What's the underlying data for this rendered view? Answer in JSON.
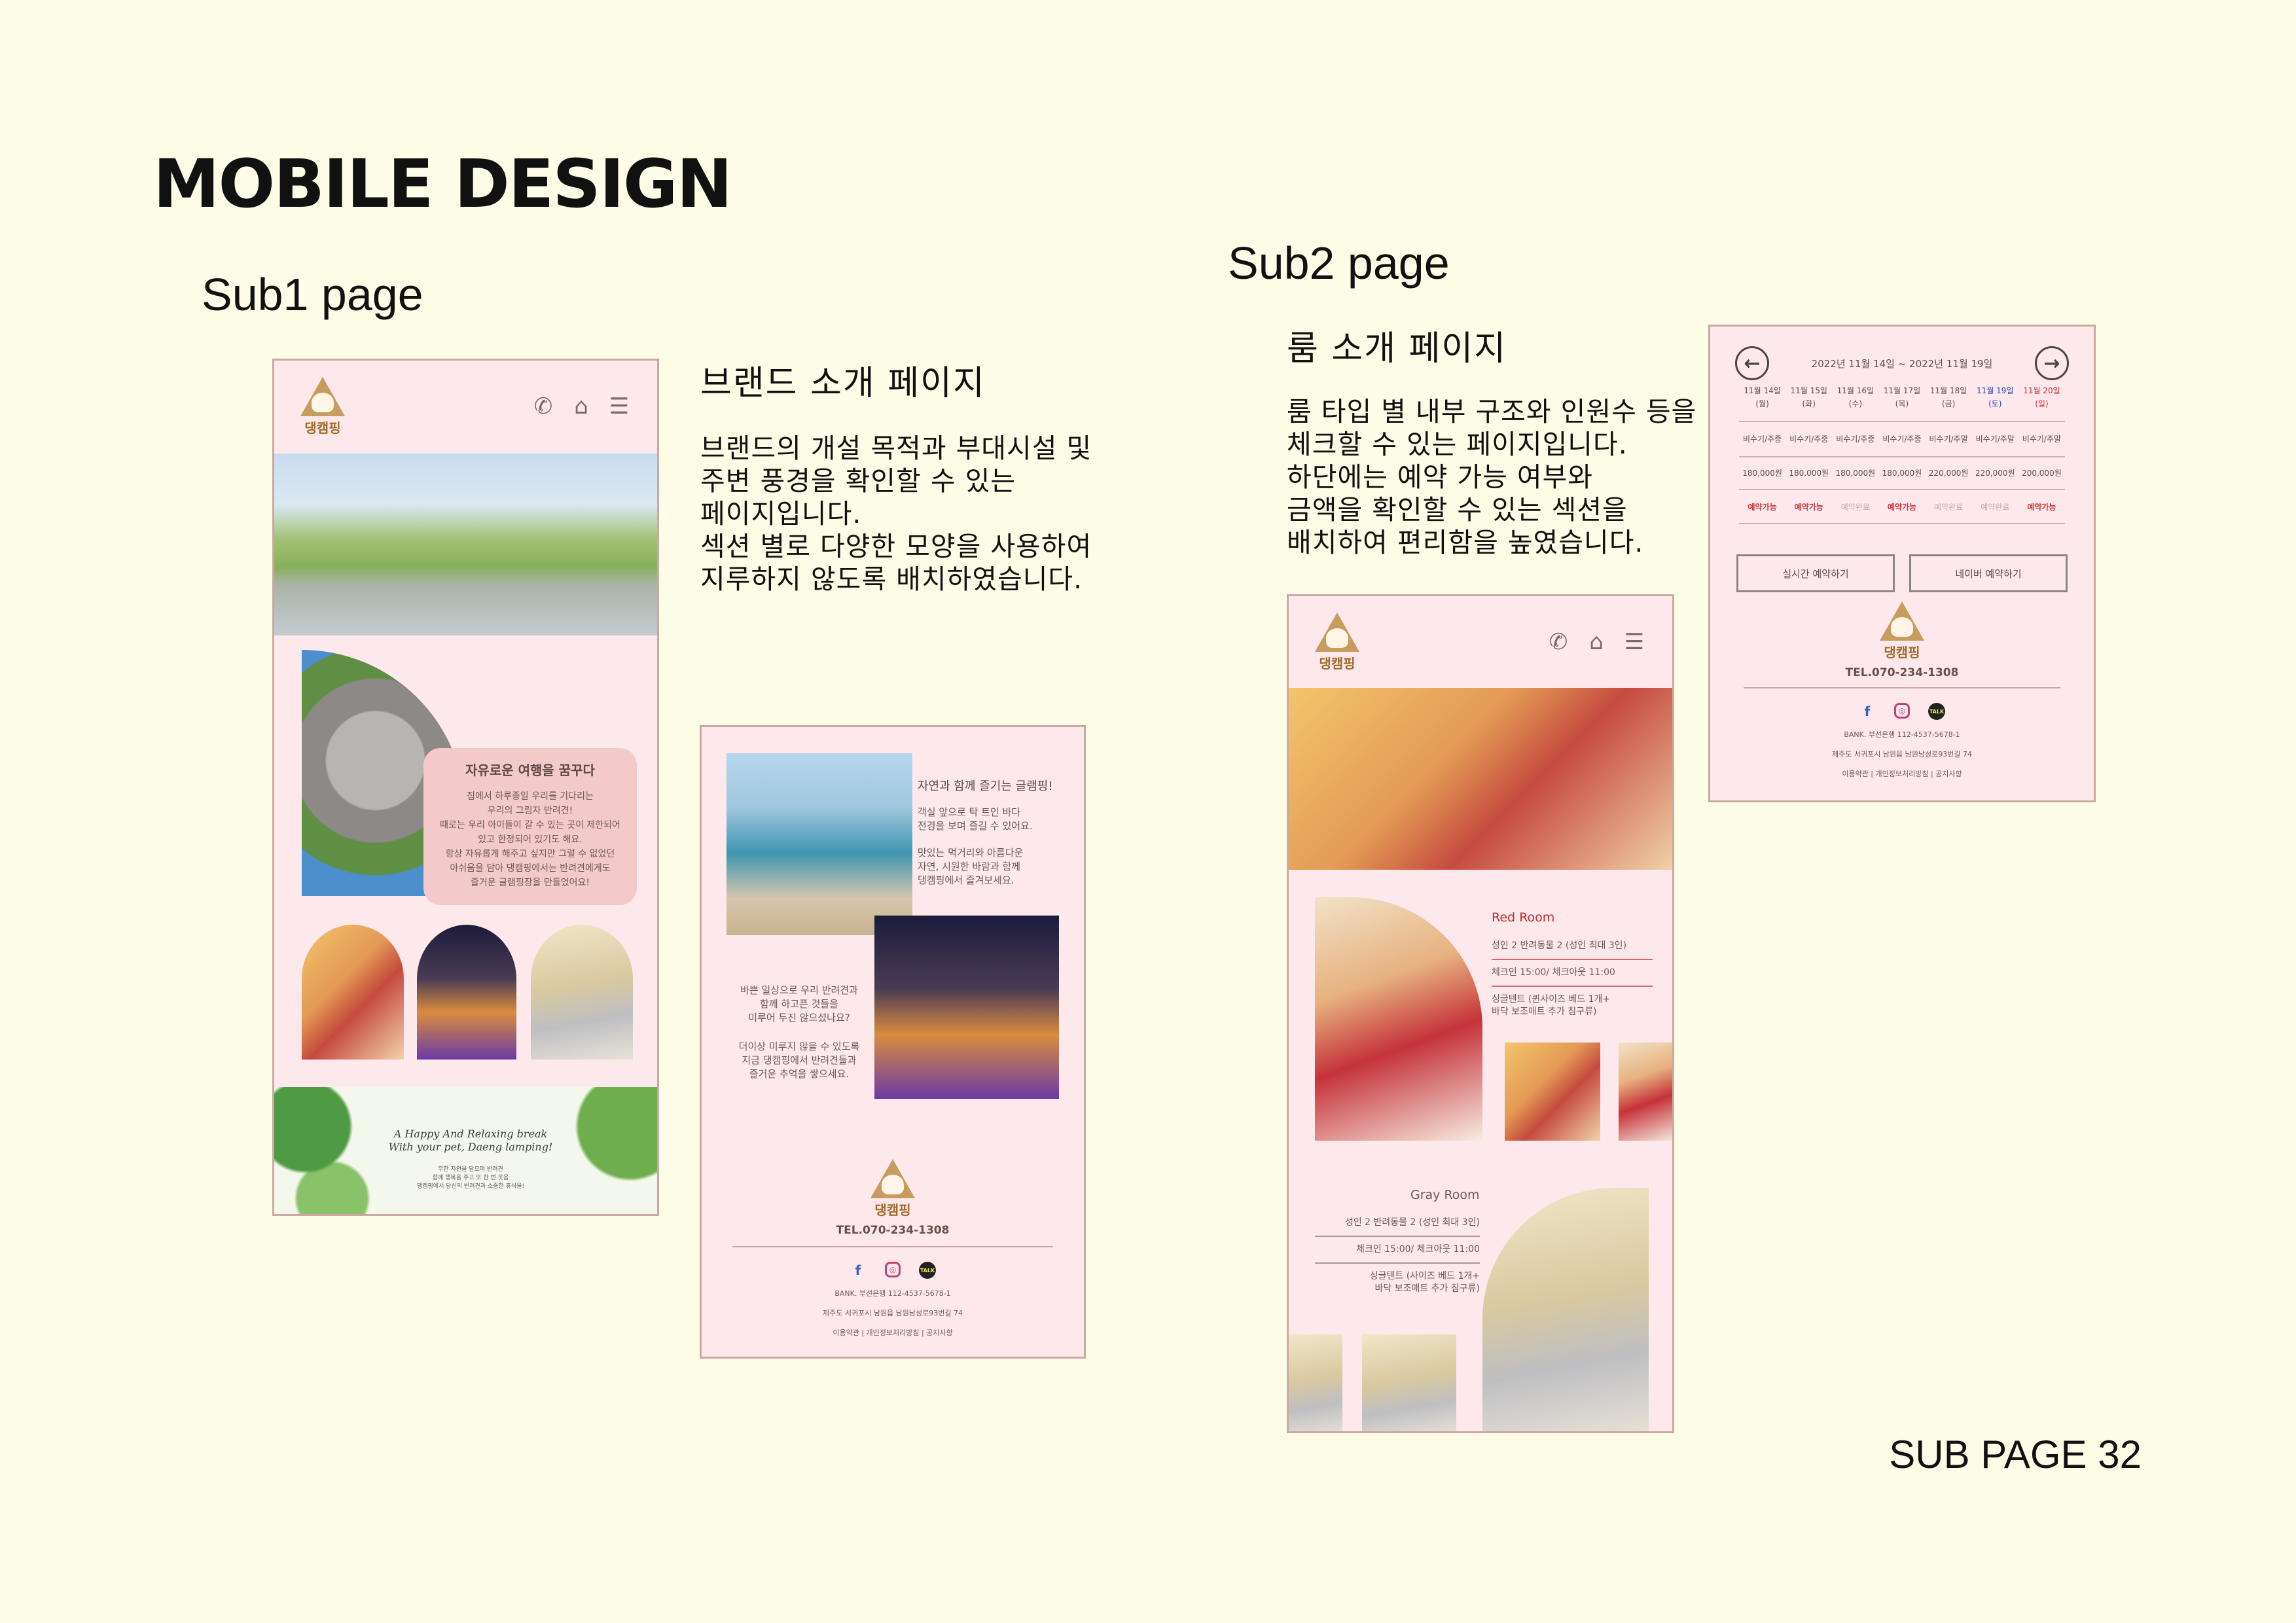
{
  "page": {
    "title": "MOBILE DESIGN",
    "footer": "SUB PAGE 32"
  },
  "sub1": {
    "heading": "Sub1 page",
    "desc_title": "브랜드 소개 페이지",
    "desc_body": "브랜드의 개설 목적과 부대시설 및\n주변 풍경을 확인할 수 있는\n페이지입니다.\n섹션 별로 다양한 모양을 사용하여\n지루하지 않도록 배치하였습니다.",
    "logo_text": "댕캠핑",
    "card_title": "자유로운 여행을 꿈꾸다",
    "card_body": "집에서 하루종일 우리를 기다리는\n우리의 그림자 반려견!\n때로는 우리 아이들이 갈 수 있는 곳이 제한되어\n있고 한정되어 있기도 해요.\n항상 자유롭게 해주고 싶지만 그럴 수 없었던\n아쉬움을 담아 댕캠핑에서는 반려견에게도\n즐거운 글램핑장을 만들었어요!",
    "tagline": "A Happy And Relaxing break\nWith your pet, Daeng lamping!",
    "tagline_small": "무한 자연을 담으며 반려견\n함께 행복을 주고 또 한 번 웃음\n댕캠핑에서 당신의 반려견과 소중한 휴식을!",
    "section_title": "자연과 함께 즐기는 글램핑!",
    "section_text1": "객실 앞으로 탁 트인 바다\n전경을 보며 즐길 수 있어요.",
    "section_text2": "맛있는 먹거리와 아름다운\n자연, 시원한 바람과 함께\n댕캠핑에서 즐겨보세요.",
    "section_text3": "바쁜 일상으로 우리 반려견과\n함께 하고픈 것들을\n미루어 두진 않으셨나요?",
    "section_text4": "더이상 미루지 않을 수 있도록\n지금 댕캠핑에서 반려견들과\n즐거운 추억을 쌓으세요.",
    "tel": "TEL.070-234-1308",
    "bank": "BANK. 부선은행 112-4537-5678-1",
    "address": "제주도 서귀포시 남원읍 남원남성로93번길 74",
    "links": "이용약관  |  개인정보처리방침  |  공지사항"
  },
  "sub2": {
    "heading": "Sub2 page",
    "desc_title": "룸 소개 페이지",
    "desc_body": "룸 타입 별 내부 구조와 인원수 등을\n체크할 수 있는 페이지입니다.\n하단에는 예약 가능 여부와\n금액을 확인할 수 있는 섹션을\n배치하여 편리함을 높였습니다.",
    "logo_text": "댕캠핑",
    "red_room": {
      "title": "Red Room",
      "lines": [
        "성인 2 반려동물 2 (성인 최대 3인)",
        "체크인 15:00/ 체크아웃 11:00",
        "싱글텐트 (퀸사이즈 베드 1개+\n바닥 보조매트 추가 침구류)"
      ]
    },
    "gray_room": {
      "title": "Gray Room",
      "lines": [
        "성인 2 반려동물 2 (성인 최대 3인)",
        "체크인 15:00/ 체크아웃 11:00",
        "싱글텐트 (사이즈 베드 1개+\n바닥 보조매트 추가 침구류)"
      ]
    },
    "calendar": {
      "range": "2022년 11월 14일 ~ 2022년 11월 19일",
      "days": [
        {
          "date": "11월 14일\n(월)",
          "cls": ""
        },
        {
          "date": "11월 15일\n(화)",
          "cls": ""
        },
        {
          "date": "11월 16일\n(수)",
          "cls": ""
        },
        {
          "date": "11월 17일\n(목)",
          "cls": ""
        },
        {
          "date": "11월 18일\n(금)",
          "cls": ""
        },
        {
          "date": "11월 19일\n(토)",
          "cls": "blue"
        },
        {
          "date": "11월 20일\n(일)",
          "cls": "red"
        }
      ],
      "season": [
        "비수기/주중",
        "비수기/주중",
        "비수기/주중",
        "비수기/주중",
        "비수기/주말",
        "비수기/주말",
        "비수기/주말"
      ],
      "prices": [
        "180,000원",
        "180,000원",
        "180,000원",
        "180,000원",
        "220,000원",
        "220,000원",
        "200,000원"
      ],
      "status": [
        {
          "label": "예약가능",
          "cls": "avail"
        },
        {
          "label": "예약가능",
          "cls": "avail"
        },
        {
          "label": "예약완료",
          "cls": "full"
        },
        {
          "label": "예약가능",
          "cls": "avail"
        },
        {
          "label": "예약완료",
          "cls": "full"
        },
        {
          "label": "예약완료",
          "cls": "full"
        },
        {
          "label": "예약가능",
          "cls": "avail"
        }
      ],
      "btn_realtime": "실시간 예약하기",
      "btn_naver": "네이버 예약하기"
    },
    "tel": "TEL.070-234-1308",
    "bank": "BANK. 부선은행 112-4537-5678-1",
    "address": "제주도 서귀포시 남원읍 남원남성로93번길 74",
    "links": "이용약관  |  개인정보처리방침  |  공지사항"
  },
  "icons": {
    "phone": "phone-icon",
    "tent": "tent-icon",
    "menu": "menu-icon",
    "facebook": "facebook-icon",
    "instagram": "instagram-icon",
    "talk": "kakaotalk-icon"
  },
  "colors": {
    "background": "#fdfce6",
    "frame": "#fde9ec",
    "accent_red": "#c62d2d",
    "brand_brown": "#c89b5e"
  }
}
